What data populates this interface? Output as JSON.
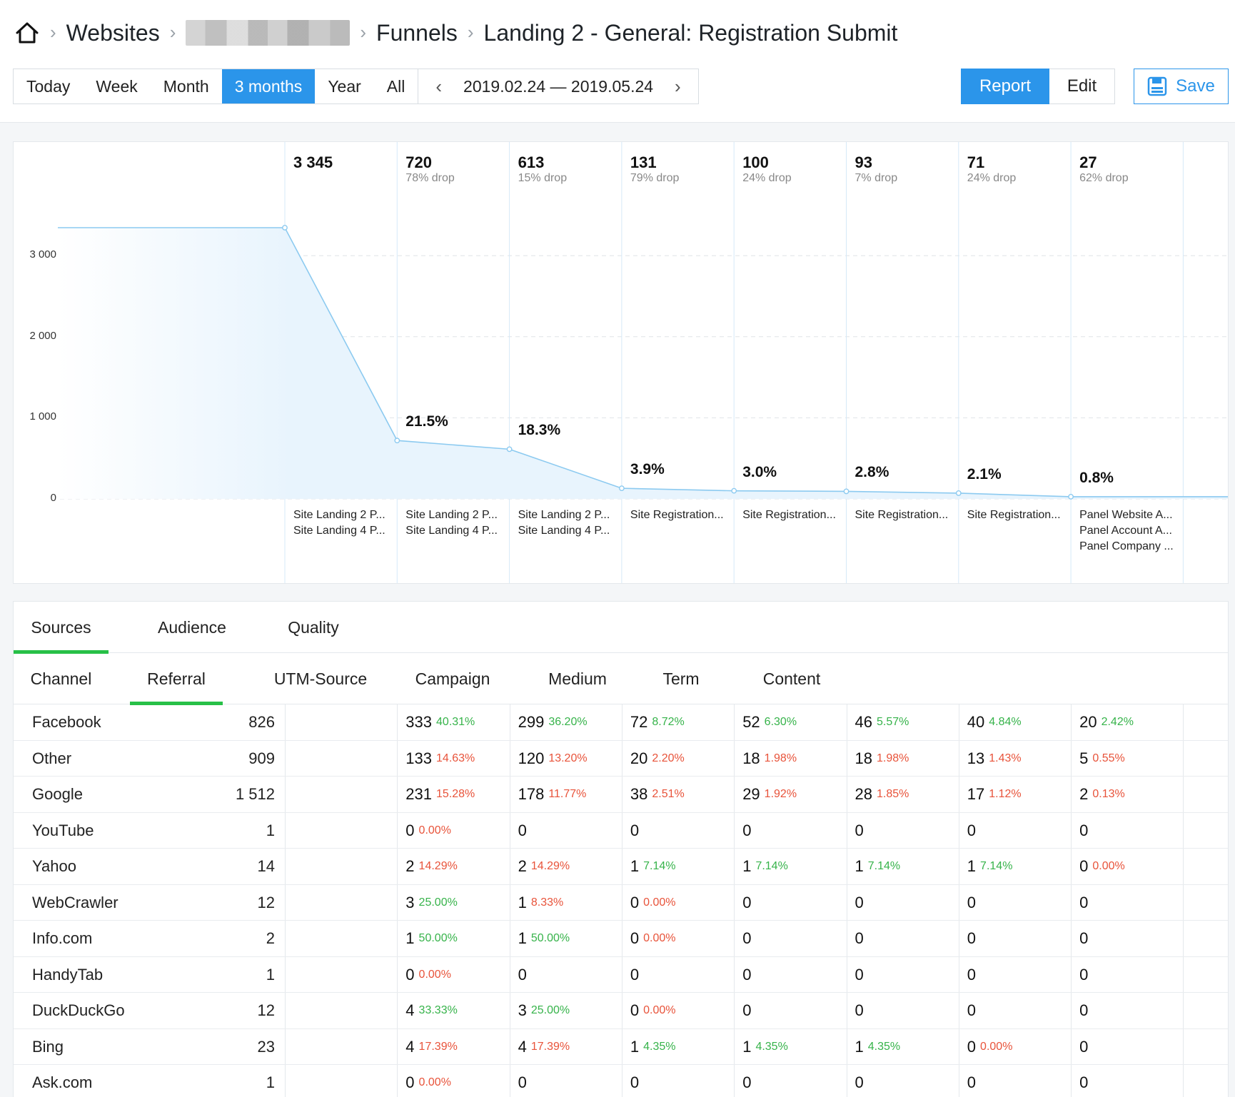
{
  "breadcrumb": {
    "items": [
      "Websites",
      "Funnels",
      "Landing 2 - General: Registration Submit"
    ]
  },
  "period": {
    "buttons": [
      "Today",
      "Week",
      "Month",
      "3 months",
      "Year",
      "All"
    ],
    "active": "3 months",
    "date_range": "2019.02.24 — 2019.05.24"
  },
  "actions": {
    "report": "Report",
    "edit": "Edit",
    "save": "Save"
  },
  "colors": {
    "accent": "#2b95ea",
    "good": "#36b34a",
    "bad": "#e8533a",
    "tab_underline": "#27c047",
    "line": "#8ccaf0"
  },
  "chart_data": {
    "type": "area",
    "y_ticks": [
      "3 000",
      "2 000",
      "1 000",
      "0"
    ],
    "ylim": [
      0,
      3345
    ],
    "steps": [
      {
        "count": "3 345",
        "value": 3345,
        "drop": "",
        "pct": "",
        "labels": [
          "Site Landing 2 P...",
          "Site Landing 4 P..."
        ]
      },
      {
        "count": "720",
        "value": 720,
        "drop": "78% drop",
        "pct": "21.5%",
        "labels": [
          "Site Landing 2 P...",
          "Site Landing 4 P..."
        ]
      },
      {
        "count": "613",
        "value": 613,
        "drop": "15% drop",
        "pct": "18.3%",
        "labels": [
          "Site Landing 2 P...",
          "Site Landing 4 P..."
        ]
      },
      {
        "count": "131",
        "value": 131,
        "drop": "79% drop",
        "pct": "3.9%",
        "labels": [
          "Site Registration..."
        ]
      },
      {
        "count": "100",
        "value": 100,
        "drop": "24% drop",
        "pct": "3.0%",
        "labels": [
          "Site Registration..."
        ]
      },
      {
        "count": "93",
        "value": 93,
        "drop": "7% drop",
        "pct": "2.8%",
        "labels": [
          "Site Registration..."
        ]
      },
      {
        "count": "71",
        "value": 71,
        "drop": "24% drop",
        "pct": "2.1%",
        "labels": [
          "Site Registration..."
        ]
      },
      {
        "count": "27",
        "value": 27,
        "drop": "62% drop",
        "pct": "0.8%",
        "labels": [
          "Panel Website A...",
          "Panel Account A...",
          "Panel Company ..."
        ]
      }
    ]
  },
  "tabs": {
    "primary": [
      "Sources",
      "Audience",
      "Quality"
    ],
    "primary_active": "Sources",
    "secondary": [
      "Channel",
      "Referral",
      "UTM-Source",
      "Campaign",
      "Medium",
      "Term",
      "Content"
    ],
    "secondary_active": "Referral"
  },
  "table": {
    "rows": [
      {
        "name": "Facebook",
        "total": "826",
        "cells": [
          [
            "333",
            "40.31%",
            "good"
          ],
          [
            "299",
            "36.20%",
            "good"
          ],
          [
            "72",
            "8.72%",
            "good"
          ],
          [
            "52",
            "6.30%",
            "good"
          ],
          [
            "46",
            "5.57%",
            "good"
          ],
          [
            "40",
            "4.84%",
            "good"
          ],
          [
            "20",
            "2.42%",
            "good"
          ]
        ]
      },
      {
        "name": "Other",
        "total": "909",
        "cells": [
          [
            "133",
            "14.63%",
            "bad"
          ],
          [
            "120",
            "13.20%",
            "bad"
          ],
          [
            "20",
            "2.20%",
            "bad"
          ],
          [
            "18",
            "1.98%",
            "bad"
          ],
          [
            "18",
            "1.98%",
            "bad"
          ],
          [
            "13",
            "1.43%",
            "bad"
          ],
          [
            "5",
            "0.55%",
            "bad"
          ]
        ]
      },
      {
        "name": "Google",
        "total": "1 512",
        "cells": [
          [
            "231",
            "15.28%",
            "bad"
          ],
          [
            "178",
            "11.77%",
            "bad"
          ],
          [
            "38",
            "2.51%",
            "bad"
          ],
          [
            "29",
            "1.92%",
            "bad"
          ],
          [
            "28",
            "1.85%",
            "bad"
          ],
          [
            "17",
            "1.12%",
            "bad"
          ],
          [
            "2",
            "0.13%",
            "bad"
          ]
        ]
      },
      {
        "name": "YouTube",
        "total": "1",
        "cells": [
          [
            "0",
            "0.00%",
            "bad"
          ],
          [
            "0",
            "",
            ""
          ],
          [
            "0",
            "",
            ""
          ],
          [
            "0",
            "",
            ""
          ],
          [
            "0",
            "",
            ""
          ],
          [
            "0",
            "",
            ""
          ],
          [
            "0",
            "",
            ""
          ]
        ]
      },
      {
        "name": "Yahoo",
        "total": "14",
        "cells": [
          [
            "2",
            "14.29%",
            "bad"
          ],
          [
            "2",
            "14.29%",
            "bad"
          ],
          [
            "1",
            "7.14%",
            "good"
          ],
          [
            "1",
            "7.14%",
            "good"
          ],
          [
            "1",
            "7.14%",
            "good"
          ],
          [
            "1",
            "7.14%",
            "good"
          ],
          [
            "0",
            "0.00%",
            "bad"
          ]
        ]
      },
      {
        "name": "WebCrawler",
        "total": "12",
        "cells": [
          [
            "3",
            "25.00%",
            "good"
          ],
          [
            "1",
            "8.33%",
            "bad"
          ],
          [
            "0",
            "0.00%",
            "bad"
          ],
          [
            "0",
            "",
            ""
          ],
          [
            "0",
            "",
            ""
          ],
          [
            "0",
            "",
            ""
          ],
          [
            "0",
            "",
            ""
          ]
        ]
      },
      {
        "name": "Info.com",
        "total": "2",
        "cells": [
          [
            "1",
            "50.00%",
            "good"
          ],
          [
            "1",
            "50.00%",
            "good"
          ],
          [
            "0",
            "0.00%",
            "bad"
          ],
          [
            "0",
            "",
            ""
          ],
          [
            "0",
            "",
            ""
          ],
          [
            "0",
            "",
            ""
          ],
          [
            "0",
            "",
            ""
          ]
        ]
      },
      {
        "name": "HandyTab",
        "total": "1",
        "cells": [
          [
            "0",
            "0.00%",
            "bad"
          ],
          [
            "0",
            "",
            ""
          ],
          [
            "0",
            "",
            ""
          ],
          [
            "0",
            "",
            ""
          ],
          [
            "0",
            "",
            ""
          ],
          [
            "0",
            "",
            ""
          ],
          [
            "0",
            "",
            ""
          ]
        ]
      },
      {
        "name": "DuckDuckGo",
        "total": "12",
        "cells": [
          [
            "4",
            "33.33%",
            "good"
          ],
          [
            "3",
            "25.00%",
            "good"
          ],
          [
            "0",
            "0.00%",
            "bad"
          ],
          [
            "0",
            "",
            ""
          ],
          [
            "0",
            "",
            ""
          ],
          [
            "0",
            "",
            ""
          ],
          [
            "0",
            "",
            ""
          ]
        ]
      },
      {
        "name": "Bing",
        "total": "23",
        "cells": [
          [
            "4",
            "17.39%",
            "bad"
          ],
          [
            "4",
            "17.39%",
            "bad"
          ],
          [
            "1",
            "4.35%",
            "good"
          ],
          [
            "1",
            "4.35%",
            "good"
          ],
          [
            "1",
            "4.35%",
            "good"
          ],
          [
            "0",
            "0.00%",
            "bad"
          ],
          [
            "0",
            "",
            ""
          ]
        ]
      },
      {
        "name": "Ask.com",
        "total": "1",
        "cells": [
          [
            "0",
            "0.00%",
            "bad"
          ],
          [
            "0",
            "",
            ""
          ],
          [
            "0",
            "",
            ""
          ],
          [
            "0",
            "",
            ""
          ],
          [
            "0",
            "",
            ""
          ],
          [
            "0",
            "",
            ""
          ],
          [
            "0",
            "",
            ""
          ]
        ]
      }
    ]
  }
}
